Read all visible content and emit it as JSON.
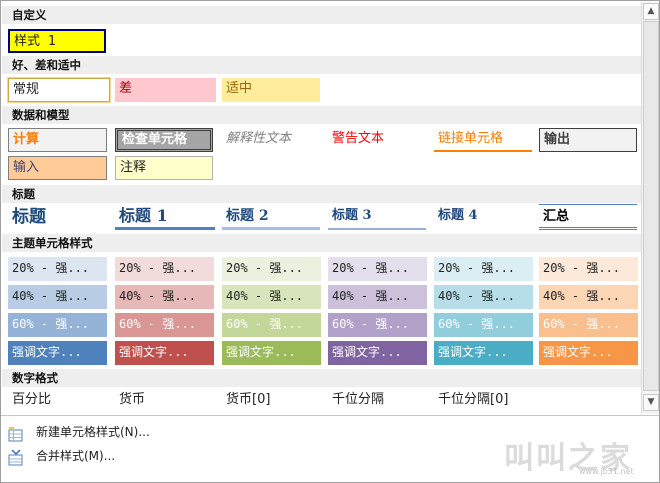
{
  "sections": {
    "custom": "自定义",
    "good_bad": "好、差和适中",
    "data_model": "数据和模型",
    "titles": "标题",
    "theme": "主题单元格样式",
    "number": "数字格式"
  },
  "custom": {
    "style1": "样式 1"
  },
  "good_bad": {
    "normal": "常规",
    "bad": "差",
    "neutral": "适中"
  },
  "data_model": {
    "calc": "计算",
    "check": "检查单元格",
    "explain": "解释性文本",
    "warn": "警告文本",
    "linked": "链接单元格",
    "output": "输出",
    "input": "输入",
    "note": "注释"
  },
  "titles": {
    "title": "标题",
    "h1": "标题 1",
    "h2": "标题 2",
    "h3": "标题 3",
    "h4": "标题 4",
    "total": "汇总"
  },
  "theme": {
    "row20": [
      "20% - 强...",
      "20% - 强...",
      "20% - 强...",
      "20% - 强...",
      "20% - 强...",
      "20% - 强..."
    ],
    "row40": [
      "40% - 强...",
      "40% - 强...",
      "40% - 强...",
      "40% - 强...",
      "40% - 强...",
      "40% - 强..."
    ],
    "row60": [
      "60% - 强...",
      "60% - 强...",
      "60% - 强...",
      "60% - 强...",
      "60% - 强...",
      "60% - 强..."
    ],
    "rowAccent": [
      "强调文字...",
      "强调文字...",
      "强调文字...",
      "强调文字...",
      "强调文字...",
      "强调文字..."
    ],
    "colors20": [
      "#dce6f1",
      "#f2dcdb",
      "#ebf1de",
      "#e4dfec",
      "#daeef3",
      "#fde9d9"
    ],
    "colors40": [
      "#b8cce4",
      "#e6b8b7",
      "#d8e4bc",
      "#ccc0da",
      "#b7dee8",
      "#fcd5b4"
    ],
    "colors60": [
      "#95b3d7",
      "#da9694",
      "#c4d79b",
      "#b1a0c7",
      "#92cddc",
      "#fabf8f"
    ],
    "colorsAccent": [
      "#4f81bd",
      "#c0504d",
      "#9bbb59",
      "#8064a2",
      "#4bacc6",
      "#f79646"
    ]
  },
  "number": {
    "percent": "百分比",
    "currency": "货币",
    "currency0": "货币[0]",
    "comma": "千位分隔",
    "comma0": "千位分隔[0]"
  },
  "footer": {
    "new_style": "新建单元格样式(N)...",
    "merge": "合并样式(M)..."
  },
  "watermark": {
    "main": "叫叫之家",
    "sub": "www.jb51.net"
  }
}
